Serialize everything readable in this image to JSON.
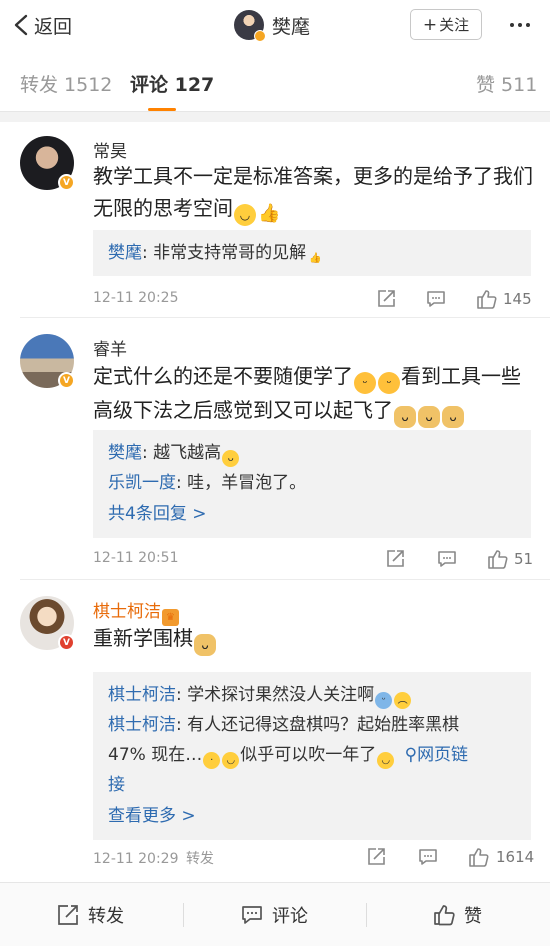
{
  "nav": {
    "back_label": "返回",
    "user_name": "樊麾",
    "follow_label": "关注"
  },
  "tabs": {
    "repost": "转发 1512",
    "comments": "评论 127",
    "likes": "赞 511"
  },
  "comments": [
    {
      "name": "常昊",
      "text_line1": "教学工具不一定是标准答案，更多的是给予了我们",
      "text_line2": "无限的思考空间",
      "replies": [
        {
          "name": "樊麾",
          "text": "非常支持常哥的见解"
        }
      ],
      "time": "12-11 20:25",
      "likes": "145"
    },
    {
      "name": "睿羊",
      "text_line1": "定式什么的还是不要随便学了",
      "text_line1b": "看到工具一些",
      "text_line2": "高级下法之后感觉到又可以起飞了",
      "replies": [
        {
          "name": "樊麾",
          "text": "越飞越高"
        },
        {
          "name": "乐凯一度",
          "text": "哇，羊冒泡了。"
        }
      ],
      "more_replies": "共4条回复 >",
      "time": "12-11 20:51",
      "likes": "51"
    },
    {
      "name": "棋士柯洁",
      "text": "重新学围棋",
      "replies": [
        {
          "name": "棋士柯洁",
          "text": "学术探讨果然没人关注啊"
        },
        {
          "name": "棋士柯洁",
          "text": "有人还记得这盘棋吗？起始胜率黑棋",
          "text_line2": "47% 现在…",
          "text_line2b": "似乎可以吹一年了",
          "link": "网页链",
          "text_line3": "接"
        }
      ],
      "more_replies": "查看更多 >",
      "time": "12-11 20:29",
      "repost_label": "转发",
      "likes": "1614"
    }
  ],
  "toolbar": {
    "repost": "转发",
    "comment": "评论",
    "like": "赞"
  },
  "colors": {
    "accent": "#ff8200",
    "link": "#2e6bb0",
    "verified_gold": "#f5a623",
    "verified_red": "#e0412f"
  }
}
